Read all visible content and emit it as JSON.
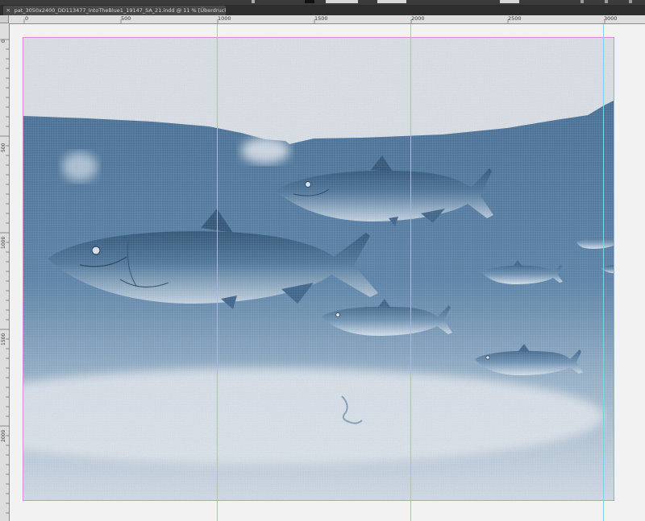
{
  "window": {
    "tab_close_symbol": "×",
    "tab_title": "pat_3050x2400_DD113477_IntoTheBlue1_19147_SA_21.indd @ 11 % [Überdruckenvorschau]"
  },
  "rulers": {
    "horizontal_labels": [
      "0",
      "500",
      "1000",
      "1500",
      "2000",
      "2500",
      "3000"
    ],
    "vertical_labels": [
      "0",
      "500",
      "1000",
      "1500",
      "2000"
    ]
  },
  "artwork": {
    "description_icon": "salmon-illustration",
    "water_color": "#436b91",
    "light_color": "#dfe3e8"
  },
  "colors": {
    "frame_bleed": "#d28fd0",
    "guide": "#7fd3e0",
    "pasteboard": "#f2f2f2"
  }
}
